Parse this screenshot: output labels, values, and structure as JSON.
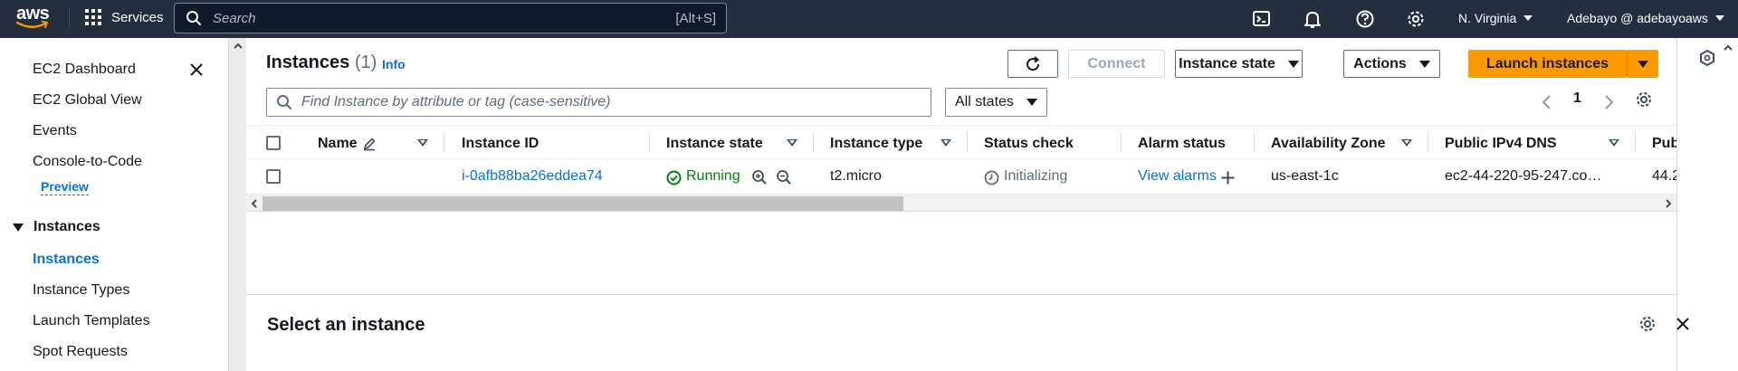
{
  "topnav": {
    "logo_text": "aws",
    "services": "Services",
    "search_placeholder": "Search",
    "search_shortcut": "[Alt+S]",
    "region": "N. Virginia",
    "account": "Adebayo @ adebayoaws"
  },
  "sidebar": {
    "items": [
      "EC2 Dashboard",
      "EC2 Global View",
      "Events",
      "Console-to-Code"
    ],
    "preview_badge": "Preview",
    "section": "Instances",
    "section_items": [
      "Instances",
      "Instance Types",
      "Launch Templates",
      "Spot Requests"
    ]
  },
  "header": {
    "title": "Instances",
    "count": "(1)",
    "info": "Info"
  },
  "toolbar": {
    "connect": "Connect",
    "instance_state": "Instance state",
    "actions": "Actions",
    "launch": "Launch instances"
  },
  "filter": {
    "placeholder": "Find Instance by attribute or tag (case-sensitive)",
    "states": "All states",
    "page": "1"
  },
  "table": {
    "columns": [
      "Name",
      "Instance ID",
      "Instance state",
      "Instance type",
      "Status check",
      "Alarm status",
      "Availability Zone",
      "Public IPv4 DNS",
      "Pub"
    ],
    "rows": [
      {
        "name": "",
        "instance_id": "i-0afb88ba26eddea74",
        "state": "Running",
        "type": "t2.micro",
        "status_check": "Initializing",
        "alarm": "View alarms",
        "az": "us-east-1c",
        "dns": "ec2-44-220-95-247.co…",
        "ip": "44.2"
      }
    ]
  },
  "details": {
    "title": "Select an instance",
    "drag_glyph": "="
  },
  "colors": {
    "nav_bg": "#232f3e",
    "accent": "#0972d3",
    "primary": "#ff9900",
    "success": "#037f0c"
  }
}
